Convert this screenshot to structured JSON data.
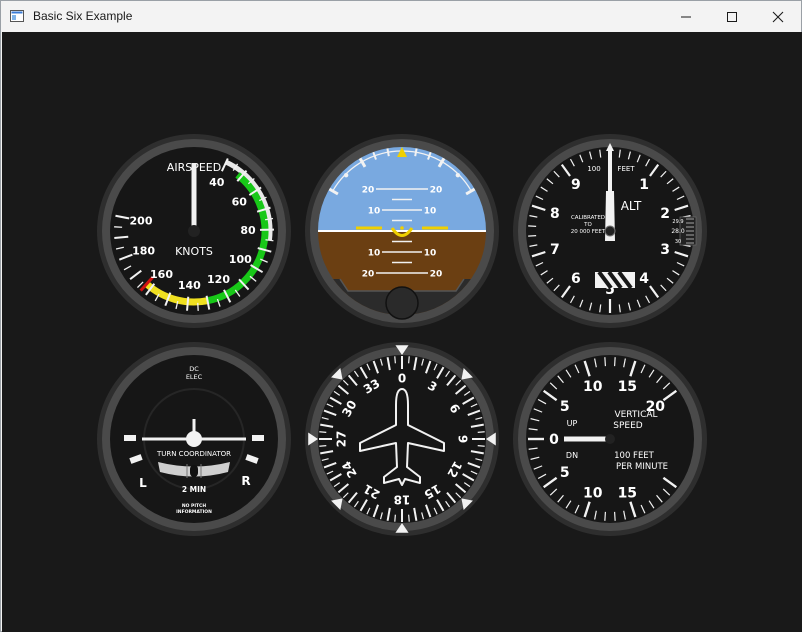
{
  "window": {
    "title": "Basic Six Example",
    "controls": {
      "minimize": "minimize",
      "maximize": "maximize",
      "close": "close"
    }
  },
  "colors": {
    "background": "#191919",
    "bezel": "#3a3a3a",
    "face": "#121212",
    "sky": "#79a9e0",
    "ground": "#6b3f12",
    "green_arc": "#18c818",
    "yellow_arc": "#f0e020",
    "white_arc": "#e8e8e8",
    "red_line": "#d01010",
    "attitude_reference": "#f0d000"
  },
  "instruments": {
    "airspeed": {
      "title": "AIRSPEED",
      "unit": "KNOTS",
      "labels": [
        "40",
        "60",
        "80",
        "100",
        "120",
        "140",
        "160",
        "180",
        "200"
      ],
      "indicated_value": 0
    },
    "attitude": {
      "pitch_labels": [
        "20",
        "20",
        "10",
        "10",
        "10",
        "10",
        "20",
        "20"
      ],
      "pitch_deg": 0,
      "roll_deg": 0
    },
    "altimeter": {
      "label": "ALT",
      "scale_labels": [
        "0",
        "1",
        "2",
        "3",
        "4",
        "5",
        "6",
        "7",
        "8",
        "9"
      ],
      "top_text": "100",
      "top_unit": "FEET",
      "calibration_lines": [
        "CALIBRATED",
        "TO",
        "20 000 FEET"
      ],
      "kollsman_labels": [
        "29.9",
        "28.0",
        "30"
      ],
      "altitude_ft": 0
    },
    "turn_coordinator": {
      "power_label_1": "DC",
      "power_label_2": "ELEC",
      "title": "TURN COORDINATOR",
      "time_label": "2 MIN",
      "left_label": "L",
      "right_label": "R",
      "footer_1": "NO PITCH",
      "footer_2": "INFORMATION"
    },
    "heading": {
      "labels": [
        "0",
        "3",
        "6",
        "9",
        "12",
        "15",
        "18",
        "21",
        "24",
        "27",
        "30",
        "33"
      ],
      "heading_deg": 0
    },
    "vertical_speed": {
      "title_1": "VERTICAL",
      "title_2": "SPEED",
      "unit_1": "100 FEET",
      "unit_2": "PER MINUTE",
      "up_label": "UP",
      "down_label": "DN",
      "scale_labels": [
        "0",
        "5",
        "10",
        "15",
        "20",
        "15",
        "10",
        "5"
      ],
      "value_fpm": 0
    }
  }
}
